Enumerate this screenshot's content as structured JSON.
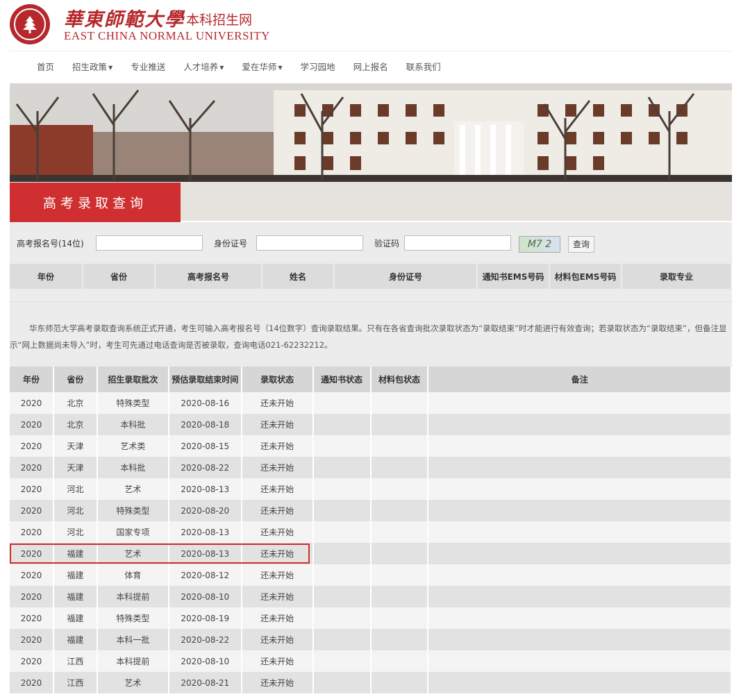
{
  "header": {
    "brand_cn": "華東師範大學",
    "brand_sub": "本科招生网",
    "brand_en": "EAST CHINA NORMAL UNIVERSITY"
  },
  "nav": {
    "items": [
      {
        "label": "首页",
        "dropdown": false
      },
      {
        "label": "招生政策",
        "dropdown": true
      },
      {
        "label": "专业推送",
        "dropdown": false
      },
      {
        "label": "人才培养",
        "dropdown": true
      },
      {
        "label": "爱在华师",
        "dropdown": true
      },
      {
        "label": "学习园地",
        "dropdown": false
      },
      {
        "label": "网上报名",
        "dropdown": false
      },
      {
        "label": "联系我们",
        "dropdown": false
      }
    ]
  },
  "banner": {
    "title": "高考录取查询"
  },
  "query_form": {
    "exam_no_label": "高考报名号(14位)",
    "exam_no_value": "",
    "id_label": "身份证号",
    "id_value": "",
    "captcha_label": "验证码",
    "captcha_value": "",
    "captcha_text": "M7 2",
    "submit_label": "查询"
  },
  "result_headers": [
    "年份",
    "省份",
    "高考报名号",
    "姓名",
    "身份证号",
    "通知书EMS号码",
    "材料包EMS号码",
    "录取专业"
  ],
  "notice": "华东师范大学高考录取查询系统正式开通，考生可输入高考报名号（14位数字）查询录取结果。只有在各省查询批次录取状态为“录取结束”时才能进行有效查询；若录取状态为“录取结束”，但备注显示“网上数据尚未导入”时，考生可先通过电话查询是否被录取，查询电话021-62232212。",
  "status_table": {
    "headers": [
      "年份",
      "省份",
      "招生录取批次",
      "预估录取结束时间",
      "录取状态",
      "通知书状态",
      "材料包状态",
      "备注"
    ],
    "rows": [
      [
        "2020",
        "北京",
        "特殊类型",
        "2020-08-16",
        "还未开始",
        "",
        "",
        ""
      ],
      [
        "2020",
        "北京",
        "本科批",
        "2020-08-18",
        "还未开始",
        "",
        "",
        ""
      ],
      [
        "2020",
        "天津",
        "艺术类",
        "2020-08-15",
        "还未开始",
        "",
        "",
        ""
      ],
      [
        "2020",
        "天津",
        "本科批",
        "2020-08-22",
        "还未开始",
        "",
        "",
        ""
      ],
      [
        "2020",
        "河北",
        "艺术",
        "2020-08-13",
        "还未开始",
        "",
        "",
        ""
      ],
      [
        "2020",
        "河北",
        "特殊类型",
        "2020-08-20",
        "还未开始",
        "",
        "",
        ""
      ],
      [
        "2020",
        "河北",
        "国家专项",
        "2020-08-13",
        "还未开始",
        "",
        "",
        ""
      ],
      [
        "2020",
        "福建",
        "艺术",
        "2020-08-13",
        "还未开始",
        "",
        "",
        ""
      ],
      [
        "2020",
        "福建",
        "体育",
        "2020-08-12",
        "还未开始",
        "",
        "",
        ""
      ],
      [
        "2020",
        "福建",
        "本科提前",
        "2020-08-10",
        "还未开始",
        "",
        "",
        ""
      ],
      [
        "2020",
        "福建",
        "特殊类型",
        "2020-08-19",
        "还未开始",
        "",
        "",
        ""
      ],
      [
        "2020",
        "福建",
        "本科一批",
        "2020-08-22",
        "还未开始",
        "",
        "",
        ""
      ],
      [
        "2020",
        "江西",
        "本科提前",
        "2020-08-10",
        "还未开始",
        "",
        "",
        ""
      ],
      [
        "2020",
        "江西",
        "艺术",
        "2020-08-21",
        "还未开始",
        "",
        "",
        ""
      ]
    ],
    "highlighted_row": 7
  },
  "colors": {
    "brand_red": "#b5282c",
    "banner_red": "#cf2f30",
    "highlight_red": "#d12c2c"
  }
}
